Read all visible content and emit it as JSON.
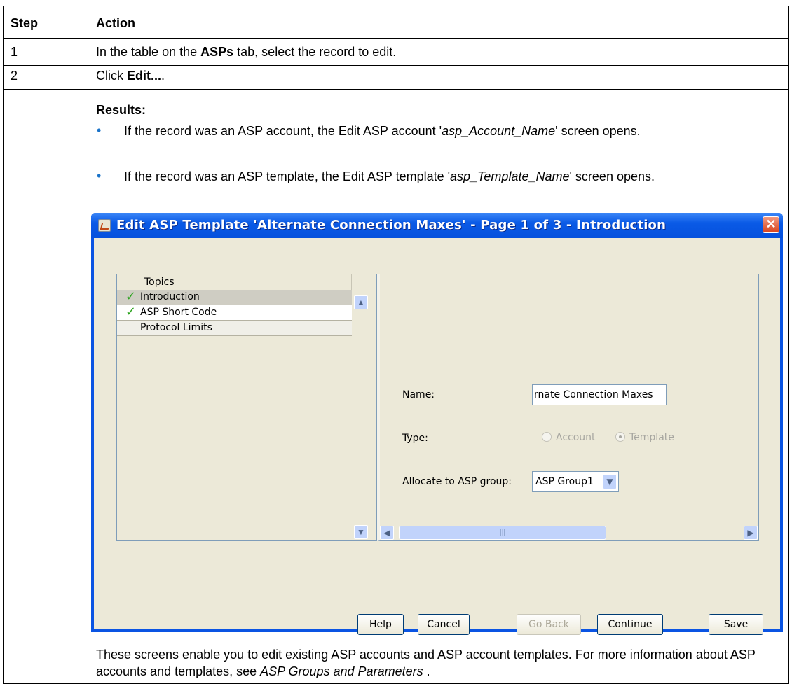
{
  "table": {
    "headers": {
      "step": "Step",
      "action": "Action"
    },
    "row1": {
      "step": "1",
      "action_pre": "In the table on the ",
      "action_bold": "ASPs",
      "action_post": " tab, select the record to edit."
    },
    "row2": {
      "step": "2",
      "click_pre": "Click ",
      "click_bold": "Edit...",
      "click_post": ".",
      "results_label": "Results:",
      "bullet1_pre": "If the record was an ASP account, the Edit ASP account '",
      "bullet1_em": "asp_Account_Name",
      "bullet1_post": "' screen opens.",
      "bullet2_pre": "If the record was an ASP template, the Edit ASP template '",
      "bullet2_em": "asp_Template_Name",
      "bullet2_post": "' screen opens.",
      "footer_pre": "These screens enable you to edit existing ASP accounts and ASP account templates. For more information about ASP accounts and templates, see ",
      "footer_em": "ASP Groups and Parameters",
      "footer_post": " ."
    }
  },
  "dialog": {
    "title": "Edit ASP Template 'Alternate Connection Maxes' - Page 1 of 3 - Introduction",
    "close_icon": "close-x-icon",
    "topics": {
      "header": "Topics",
      "items": [
        {
          "label": "Introduction",
          "checked": true,
          "selected": true
        },
        {
          "label": "ASP Short Code",
          "checked": true,
          "selected": false
        },
        {
          "label": "Protocol Limits",
          "checked": false,
          "selected": false
        }
      ]
    },
    "form": {
      "name_label": "Name:",
      "name_value": "rnate Connection Maxes",
      "type_label": "Type:",
      "type_option_account": "Account",
      "type_option_template": "Template",
      "type_selected": "Template",
      "group_label": "Allocate to ASP group:",
      "group_value": "ASP Group1"
    },
    "buttons": {
      "help": "Help",
      "cancel": "Cancel",
      "go_back": "Go Back",
      "continue": "Continue",
      "save": "Save"
    },
    "colors": {
      "titlebar": "#0a54e3",
      "client": "#ece9d8",
      "check": "#2ba31d",
      "bullet": "#1a73c9"
    }
  }
}
